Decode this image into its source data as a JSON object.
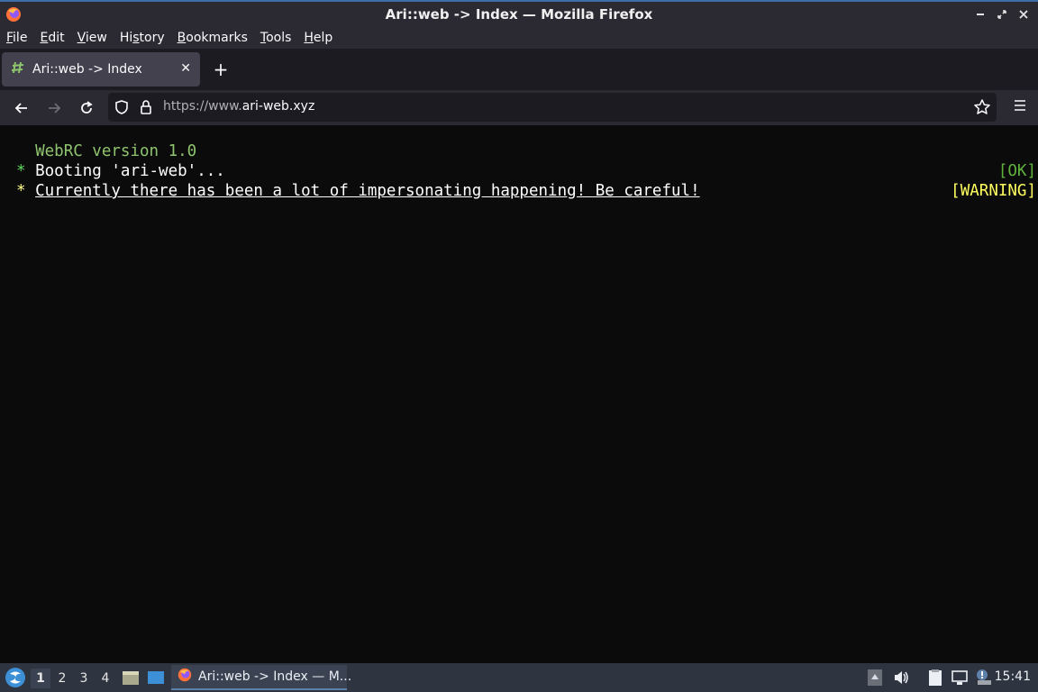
{
  "window": {
    "title": "Ari::web -> Index — Mozilla Firefox"
  },
  "menubar": {
    "items": [
      {
        "label_pre": "",
        "accel": "F",
        "label_post": "ile"
      },
      {
        "label_pre": "",
        "accel": "E",
        "label_post": "dit"
      },
      {
        "label_pre": "",
        "accel": "V",
        "label_post": "iew"
      },
      {
        "label_pre": "Hi",
        "accel": "s",
        "label_post": "tory"
      },
      {
        "label_pre": "",
        "accel": "B",
        "label_post": "ookmarks"
      },
      {
        "label_pre": "",
        "accel": "T",
        "label_post": "ools"
      },
      {
        "label_pre": "",
        "accel": "H",
        "label_post": "elp"
      }
    ]
  },
  "tabs": {
    "active_label": "Ari::web -> Index",
    "close_glyph": "✕",
    "new_tab_glyph": "+"
  },
  "navbar": {
    "url_prefix": "https://www.",
    "url_domain": "ari-web.xyz"
  },
  "page": {
    "lines": [
      {
        "bullet": " ",
        "text": "WebRC version 1.0",
        "status": ""
      },
      {
        "bullet": "*",
        "text": "Booting 'ari-web'...",
        "status": "[OK]"
      },
      {
        "bullet": "*",
        "text": "Currently there has been a lot of impersonating happening! Be careful!",
        "status": "[WARNING]"
      }
    ]
  },
  "taskbar": {
    "workspaces": [
      "1",
      "2",
      "3",
      "4"
    ],
    "active_workspace": "1",
    "firefox_task_label": "Ari::web -> Index — M...",
    "clock": "15:41"
  },
  "icons": {
    "titlebar": [
      "firefox-icon",
      "minimize-icon",
      "maximize-icon",
      "close-icon"
    ],
    "navbar": [
      "back-icon",
      "forward-icon",
      "reload-icon",
      "shield-icon",
      "lock-icon",
      "star-icon",
      "hamburger-menu-icon"
    ],
    "tray": [
      "up-arrow-icon",
      "volume-icon",
      "clipboard-icon",
      "network-icon",
      "notification-icon"
    ]
  },
  "colors": {
    "ok": "#5fb33b",
    "warning": "#ffff5f",
    "accent": "#5e81ac"
  }
}
